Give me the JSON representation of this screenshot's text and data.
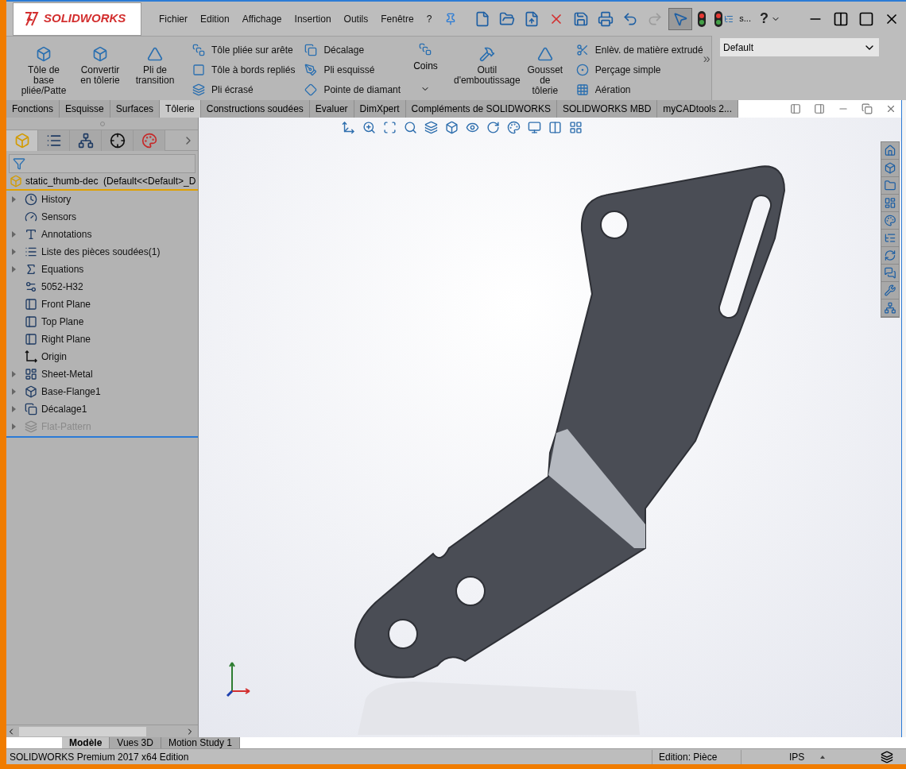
{
  "app": {
    "logo": "SOLIDWORKS"
  },
  "menu": [
    "Fichier",
    "Edition",
    "Affichage",
    "Insertion",
    "Outils",
    "Fenêtre",
    "?"
  ],
  "quick_access": [
    {
      "kind": "new"
    },
    {
      "kind": "open"
    },
    {
      "kind": "export"
    },
    {
      "kind": "close"
    },
    {
      "kind": "save"
    },
    {
      "kind": "print"
    },
    {
      "kind": "undo"
    },
    {
      "kind": "redo",
      "disabled": true
    },
    {
      "kind": "select",
      "pressed": true
    },
    {
      "kind": "traffic"
    },
    {
      "kind": "traffic-tree"
    }
  ],
  "quick_access_more": "s...",
  "help": "?",
  "ribbon": {
    "large": [
      {
        "kind": "base-flange",
        "label": "Tôle de base pliée/Patte"
      },
      {
        "kind": "convert",
        "label": "Convertir en tôlerie"
      },
      {
        "kind": "lofted",
        "label": "Pli de transition"
      }
    ],
    "column_1": [
      {
        "kind": "edge-flange",
        "label": "Tôle pliée sur arête"
      },
      {
        "kind": "hem",
        "label": "Tôle à bords repliés"
      },
      {
        "kind": "flat-hem",
        "label": "Pli écrasé"
      }
    ],
    "column_2": [
      {
        "kind": "jog",
        "label": "Décalage"
      },
      {
        "kind": "sketched-bend",
        "label": "Pli esquissé"
      },
      {
        "kind": "diamond",
        "label": "Pointe de diamant"
      }
    ],
    "corners": "Coins",
    "large_2": [
      {
        "kind": "forming",
        "label": "Outil d'emboutissage"
      },
      {
        "kind": "gusset",
        "label": "Gousset de tôlerie"
      }
    ],
    "column_3": [
      {
        "kind": "cut",
        "label": "Enlèv. de matière extrudé"
      },
      {
        "kind": "hole",
        "label": "Perçage simple"
      },
      {
        "kind": "vent",
        "label": "Aération"
      }
    ],
    "more": "»",
    "configuration": "Default"
  },
  "tabs": [
    {
      "label": "Fonctions",
      "selected": false
    },
    {
      "label": "Esquisse",
      "selected": false
    },
    {
      "label": "Surfaces",
      "selected": false
    },
    {
      "label": "Tôlerie",
      "selected": true
    },
    {
      "label": "Constructions soudées",
      "selected": false
    },
    {
      "label": "Evaluer",
      "selected": false
    },
    {
      "label": "DimXpert",
      "selected": false
    },
    {
      "label": "Compléments de SOLIDWORKS",
      "selected": false
    },
    {
      "label": "SOLIDWORKS MBD",
      "selected": false
    },
    {
      "label": "myCADtools 2...",
      "selected": false
    }
  ],
  "panel_tabs": [
    {
      "kind": "feature-tree",
      "selected": true
    },
    {
      "kind": "property",
      "selected": false
    },
    {
      "kind": "config",
      "selected": false
    },
    {
      "kind": "dimxpert",
      "selected": false
    },
    {
      "kind": "display",
      "selected": false
    }
  ],
  "tree": {
    "root": "static_thumb-dec  (Default<<Default>_D",
    "items": [
      {
        "kind": "history",
        "label": "History",
        "expandable": true,
        "disabled": false
      },
      {
        "kind": "sensors",
        "label": "Sensors",
        "expandable": false,
        "disabled": false
      },
      {
        "kind": "annotations",
        "label": "Annotations",
        "expandable": true,
        "disabled": false
      },
      {
        "kind": "cutlist",
        "label": "Liste des pièces soudées(1)",
        "expandable": true,
        "disabled": false
      },
      {
        "kind": "equations",
        "label": "Equations",
        "expandable": true,
        "disabled": false
      },
      {
        "kind": "material",
        "label": "5052-H32",
        "expandable": false,
        "disabled": false
      },
      {
        "kind": "plane",
        "label": "Front Plane",
        "expandable": false,
        "disabled": false
      },
      {
        "kind": "plane",
        "label": "Top Plane",
        "expandable": false,
        "disabled": false
      },
      {
        "kind": "plane",
        "label": "Right Plane",
        "expandable": false,
        "disabled": false
      },
      {
        "kind": "origin",
        "label": "Origin",
        "expandable": false,
        "disabled": false
      },
      {
        "kind": "sheetmetal",
        "label": "Sheet-Metal",
        "expandable": true,
        "disabled": false
      },
      {
        "kind": "flange",
        "label": "Base-Flange1",
        "expandable": true,
        "disabled": false
      },
      {
        "kind": "jog",
        "label": "Décalage1",
        "expandable": true,
        "disabled": false
      },
      {
        "kind": "flat",
        "label": "Flat-Pattern",
        "expandable": true,
        "disabled": true
      }
    ]
  },
  "bottom_tabs": [
    {
      "label": "Modèle",
      "selected": true
    },
    {
      "label": "Vues 3D",
      "selected": false
    },
    {
      "label": "Motion Study 1",
      "selected": false
    }
  ],
  "status_bar": {
    "product": "SOLIDWORKS Premium 2017 x64 Edition",
    "mode": "Edition: Pièce",
    "units": "IPS"
  }
}
